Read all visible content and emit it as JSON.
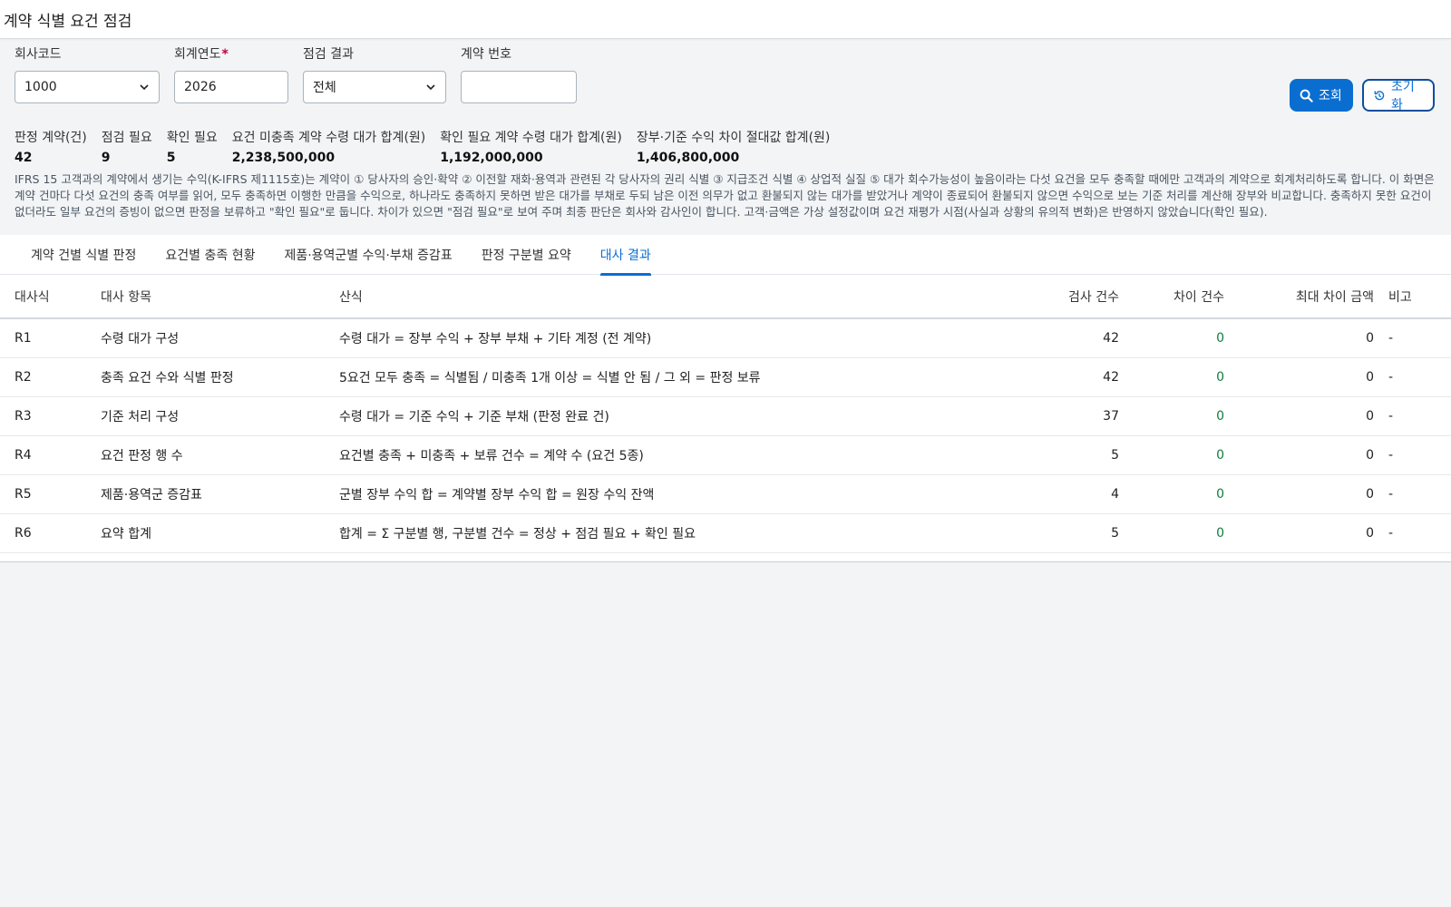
{
  "page": {
    "title": "계약 식별 요건 점검"
  },
  "filters": {
    "company_code": {
      "label": "회사코드",
      "value": "1000"
    },
    "fiscal_year": {
      "label": "회계연도",
      "required_mark": "*",
      "value": "2026"
    },
    "check_result": {
      "label": "점검 결과",
      "value": "전체"
    },
    "contract_no": {
      "label": "계약 번호",
      "value": ""
    }
  },
  "actions": {
    "search_label": "조회",
    "reset_label": "초기화"
  },
  "stats": [
    {
      "label": "판정 계약(건)",
      "value": "42"
    },
    {
      "label": "점검 필요",
      "value": "9"
    },
    {
      "label": "확인 필요",
      "value": "5"
    },
    {
      "label": "요건 미충족 계약 수령 대가 합계(원)",
      "value": "2,238,500,000"
    },
    {
      "label": "확인 필요 계약 수령 대가 합계(원)",
      "value": "1,192,000,000"
    },
    {
      "label": "장부·기준 수익 차이 절대값 합계(원)",
      "value": "1,406,800,000"
    }
  ],
  "description": "IFRS 15 고객과의 계약에서 생기는 수익(K-IFRS 제1115호)는 계약이 ① 당사자의 승인·확약 ② 이전할 재화·용역과 관련된 각 당사자의 권리 식별 ③ 지급조건 식별 ④ 상업적 실질 ⑤ 대가 회수가능성이 높음이라는 다섯 요건을 모두 충족할 때에만 고객과의 계약으로 회계처리하도록 합니다. 이 화면은 계약 건마다 다섯 요건의 충족 여부를 읽어, 모두 충족하면 이행한 만큼을 수익으로, 하나라도 충족하지 못하면 받은 대가를 부채로 두되 남은 이전 의무가 없고 환불되지 않는 대가를 받았거나 계약이 종료되어 환불되지 않으면 수익으로 보는 기준 처리를 계산해 장부와 비교합니다. 충족하지 못한 요건이 없더라도 일부 요건의 증빙이 없으면 판정을 보류하고 \"확인 필요\"로 둡니다. 차이가 있으면 \"점검 필요\"로 보여 주며 최종 판단은 회사와 감사인이 합니다. 고객·금액은 가상 설정값이며 요건 재평가 시점(사실과 상황의 유의적 변화)은 반영하지 않았습니다(확인 필요).",
  "tabs": [
    {
      "label": "계약 건별 식별 판정",
      "active": false
    },
    {
      "label": "요건별 충족 현황",
      "active": false
    },
    {
      "label": "제품·용역군별 수익·부채 증감표",
      "active": false
    },
    {
      "label": "판정 구분별 요약",
      "active": false
    },
    {
      "label": "대사 결과",
      "active": true
    }
  ],
  "table": {
    "columns": [
      "대사식",
      "대사 항목",
      "산식",
      "검사 건수",
      "차이 건수",
      "최대 차이 금액",
      "비고"
    ],
    "rows": [
      {
        "id": "R1",
        "item": "수령 대가 구성",
        "formula": "수령 대가 = 장부 수익 + 장부 부채 + 기타 계정 (전 계약)",
        "checked": "42",
        "diff_count": "0",
        "max_diff": "0",
        "note": "-"
      },
      {
        "id": "R2",
        "item": "충족 요건 수와 식별 판정",
        "formula": "5요건 모두 충족 = 식별됨 / 미충족 1개 이상 = 식별 안 됨 / 그 외 = 판정 보류",
        "checked": "42",
        "diff_count": "0",
        "max_diff": "0",
        "note": "-"
      },
      {
        "id": "R3",
        "item": "기준 처리 구성",
        "formula": "수령 대가 = 기준 수익 + 기준 부채 (판정 완료 건)",
        "checked": "37",
        "diff_count": "0",
        "max_diff": "0",
        "note": "-"
      },
      {
        "id": "R4",
        "item": "요건 판정 행 수",
        "formula": "요건별 충족 + 미충족 + 보류 건수 = 계약 수 (요건 5종)",
        "checked": "5",
        "diff_count": "0",
        "max_diff": "0",
        "note": "-"
      },
      {
        "id": "R5",
        "item": "제품·용역군 증감표",
        "formula": "군별 장부 수익 합 = 계약별 장부 수익 합 = 원장 수익 잔액",
        "checked": "4",
        "diff_count": "0",
        "max_diff": "0",
        "note": "-"
      },
      {
        "id": "R6",
        "item": "요약 합계",
        "formula": "합계 = Σ 구분별 행, 구분별 건수 = 정상 + 점검 필요 + 확인 필요",
        "checked": "5",
        "diff_count": "0",
        "max_diff": "0",
        "note": "-"
      }
    ]
  }
}
